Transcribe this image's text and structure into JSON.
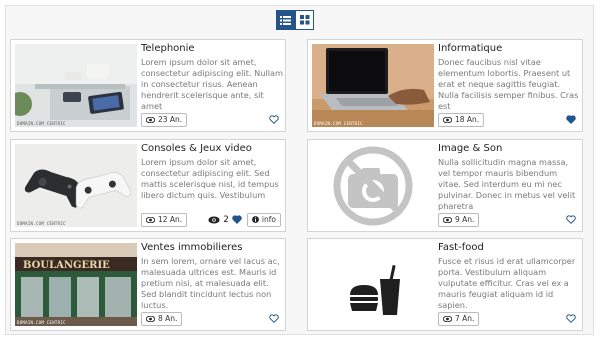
{
  "view_toggle": {
    "list_icon": "list-icon",
    "grid_icon": "grid-icon",
    "active": "list"
  },
  "colors": {
    "accent": "#24558a",
    "border": "#d4d4d4",
    "muted_text": "#7a7a7a"
  },
  "watermark": "DOMAIN.COM CENTRIC",
  "cards": [
    {
      "title": "Telephonie",
      "description": "Lorem ipsum dolor sit amet, consectetur adipiscing elit. Nullam in consectetur risus. Aenean hendrerit scelerisque ante, sit amet",
      "views": "23 An.",
      "favorited": false
    },
    {
      "title": "Informatique",
      "description": "Donec faucibus nisl vitae elementum lobortis. Praesent ut erat et neque sagittis feugiat. Nulla facilisis semper finibus. Cras est",
      "views": "18 An.",
      "favorited": true
    },
    {
      "title": "Consoles & Jeux video",
      "description": "Lorem ipsum dolor sit amet, consectetur adipiscing elit. Sed mattis scelerisque nisl, id tempus libero dictum quis. Vestibulum",
      "views": "12 An.",
      "favorited": true,
      "likes": "2",
      "info_label": "info"
    },
    {
      "title": "Image & Son",
      "description": "Nulla sollicitudin magna massa, vel tempor mauris bibendum vitae. Sed interdum eu mi nec pulvinar. Donec in metus vel velit pharetra",
      "views": "9 An.",
      "favorited": false
    },
    {
      "title": "Ventes immobilieres",
      "description": "In sem lorem, ornare vel lacus ac, malesuada ultrices est. Mauris id pretium nisi, at malesuada elit. Sed blandit tincidunt lectus non luctus.",
      "views": "8 An.",
      "favorited": false,
      "sign_text": "BOULANGERIE"
    },
    {
      "title": "Fast-food",
      "description": "Fusce et risus id erat ullamcorper porta. Vestibulum aliquam vulputate efficitur. Cras vel ex a mauris feugiat aliquam id id sapien.",
      "views": "7 An.",
      "favorited": false
    }
  ]
}
